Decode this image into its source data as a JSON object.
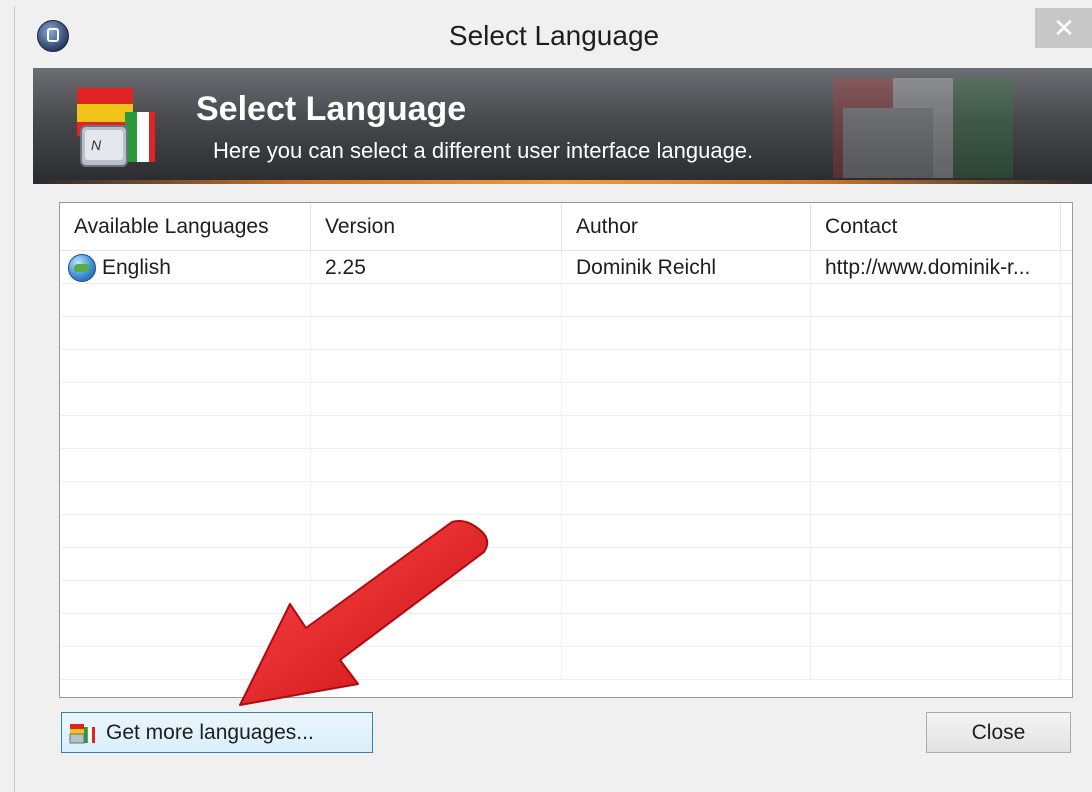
{
  "window": {
    "title": "Select Language",
    "close_glyph": "✕"
  },
  "banner": {
    "title": "Select Language",
    "subtitle": "Here you can select a different user interface language."
  },
  "list": {
    "columns": [
      "Available Languages",
      "Version",
      "Author",
      "Contact"
    ],
    "rows": [
      {
        "language": "English",
        "version": "2.25",
        "author": "Dominik Reichl",
        "contact": "http://www.dominik-r..."
      }
    ],
    "empty_rows": 12
  },
  "buttons": {
    "get_more": "Get more languages...",
    "close": "Close"
  },
  "colors": {
    "annotation_arrow": "#e8141b",
    "selection_border": "#3c7fb1",
    "banner_accent": "#f09a3e"
  },
  "icons": {
    "app": "lock-globe-icon",
    "banner": "language-flags-keyboard-icon",
    "language_row": "globe-icon",
    "get_more": "flags-icon"
  }
}
